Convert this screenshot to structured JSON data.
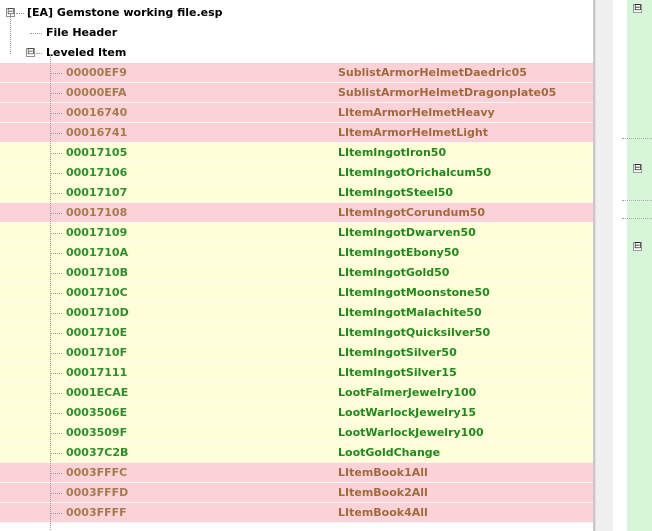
{
  "tree": {
    "file": {
      "label": "[EA] Gemstone working file.esp",
      "expander": "⊟"
    },
    "header": {
      "label": "File Header"
    },
    "group": {
      "label": "Leveled Item",
      "expander": "⊟"
    }
  },
  "rows": [
    {
      "form_id": "00000EF9",
      "editor_id": "SublistArmorHelmetDaedric05",
      "tone": "pink"
    },
    {
      "form_id": "00000EFA",
      "editor_id": "SublistArmorHelmetDragonplate05",
      "tone": "pink"
    },
    {
      "form_id": "00016740",
      "editor_id": "LItemArmorHelmetHeavy",
      "tone": "pink"
    },
    {
      "form_id": "00016741",
      "editor_id": "LItemArmorHelmetLight",
      "tone": "pink"
    },
    {
      "form_id": "00017105",
      "editor_id": "LItemIngotIron50",
      "tone": "yellow"
    },
    {
      "form_id": "00017106",
      "editor_id": "LItemIngotOrichalcum50",
      "tone": "yellow"
    },
    {
      "form_id": "00017107",
      "editor_id": "LItemIngotSteel50",
      "tone": "yellow"
    },
    {
      "form_id": "00017108",
      "editor_id": "LItemIngotCorundum50",
      "tone": "pink"
    },
    {
      "form_id": "00017109",
      "editor_id": "LItemIngotDwarven50",
      "tone": "yellow"
    },
    {
      "form_id": "0001710A",
      "editor_id": "LItemIngotEbony50",
      "tone": "yellow"
    },
    {
      "form_id": "0001710B",
      "editor_id": "LItemIngotGold50",
      "tone": "yellow"
    },
    {
      "form_id": "0001710C",
      "editor_id": "LItemIngotMoonstone50",
      "tone": "yellow"
    },
    {
      "form_id": "0001710D",
      "editor_id": "LItemIngotMalachite50",
      "tone": "yellow"
    },
    {
      "form_id": "0001710E",
      "editor_id": "LItemIngotQuicksilver50",
      "tone": "yellow"
    },
    {
      "form_id": "0001710F",
      "editor_id": "LItemIngotSilver50",
      "tone": "yellow"
    },
    {
      "form_id": "00017111",
      "editor_id": "LItemIngotSilver15",
      "tone": "yellow"
    },
    {
      "form_id": "0001ECAE",
      "editor_id": "LootFalmerJewelry100",
      "tone": "yellow"
    },
    {
      "form_id": "0003506E",
      "editor_id": "LootWarlockJewelry15",
      "tone": "yellow"
    },
    {
      "form_id": "0003509F",
      "editor_id": "LootWarlockJewelry100",
      "tone": "yellow"
    },
    {
      "form_id": "00037C2B",
      "editor_id": "LootGoldChange",
      "tone": "yellow"
    },
    {
      "form_id": "0003FFFC",
      "editor_id": "LItemBook1All",
      "tone": "pink"
    },
    {
      "form_id": "0003FFFD",
      "editor_id": "LItemBook2All",
      "tone": "pink"
    },
    {
      "form_id": "0003FFFF",
      "editor_id": "LItemBook4All",
      "tone": "pink"
    }
  ],
  "right_panel": {
    "expander": "⊟"
  }
}
